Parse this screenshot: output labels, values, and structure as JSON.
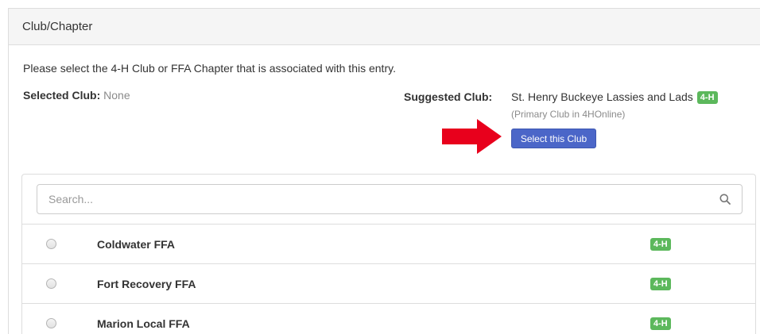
{
  "panel": {
    "title": "Club/Chapter"
  },
  "intro": "Please select the 4-H Club or FFA Chapter that is associated with this entry.",
  "selected": {
    "label": "Selected Club:",
    "value": "None"
  },
  "suggested": {
    "label": "Suggested Club:",
    "name": "St. Henry Buckeye Lassies and Lads",
    "badge": "4-H",
    "note": "(Primary Club in 4HOnline)",
    "button_label": "Select this Club"
  },
  "search": {
    "placeholder": "Search...",
    "icon": "search-icon"
  },
  "clubs": [
    {
      "name": "Coldwater FFA",
      "badge": "4-H"
    },
    {
      "name": "Fort Recovery FFA",
      "badge": "4-H"
    },
    {
      "name": "Marion Local FFA",
      "badge": "4-H"
    }
  ],
  "colors": {
    "badge": "#5cb85c",
    "button": "#4b66c8",
    "arrow": "#e8001c"
  }
}
